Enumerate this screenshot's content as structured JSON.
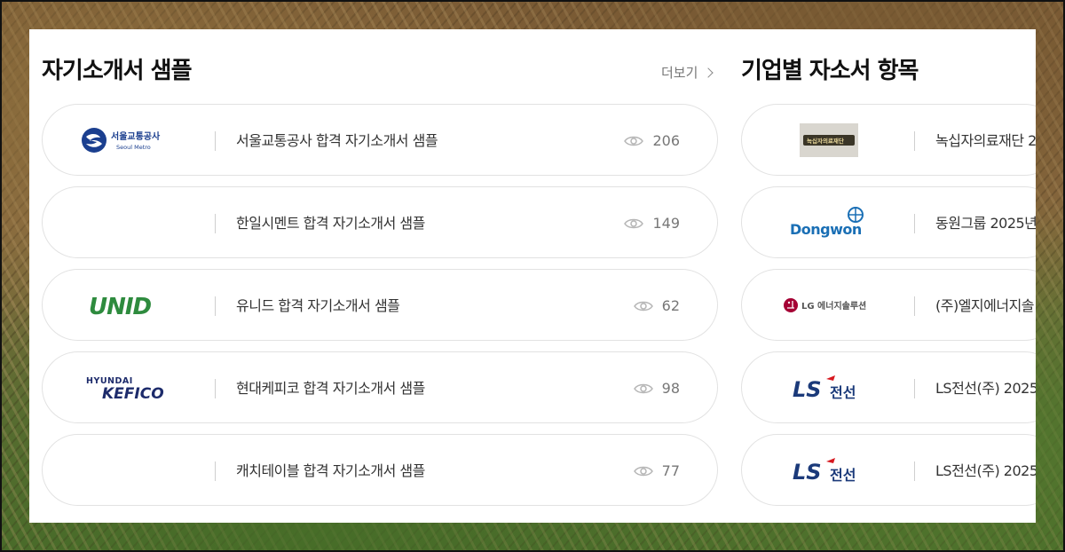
{
  "samples": {
    "title": "자기소개서 샘플",
    "more_label": "더보기",
    "items": [
      {
        "logo": "서울교통공사",
        "logo_sub": "Seoul Metro",
        "title": "서울교통공사 합격 자기소개서 샘플",
        "views": "206"
      },
      {
        "logo": "",
        "title": "한일시멘트 합격 자기소개서 샘플",
        "views": "149"
      },
      {
        "logo": "UNID",
        "title": "유니드 합격 자기소개서 샘플",
        "views": "62"
      },
      {
        "logo": "HYUNDAI",
        "logo_sub": "KEFICO",
        "title": "현대케피코 합격 자기소개서 샘플",
        "views": "98"
      },
      {
        "logo": "",
        "title": "캐치테이블 합격 자기소개서 샘플",
        "views": "77"
      }
    ]
  },
  "company": {
    "title": "기업별 자소서 항목",
    "items": [
      {
        "logo": "녹십자의료재단",
        "title": "녹십자의료재단 2"
      },
      {
        "logo": "Dongwon",
        "title": "동원그룹 2025년"
      },
      {
        "logo": "LG 에너지솔루션",
        "title": "(주)엘지에너지솔"
      },
      {
        "logo": "LS",
        "logo_sub": "전선",
        "title": "LS전선(주) 2025"
      },
      {
        "logo": "LS",
        "logo_sub": "전선",
        "title": "LS전선(주) 2025"
      }
    ]
  },
  "colors": {
    "unid_green": "#2e8b3e",
    "kefico_navy": "#1d2b6b",
    "dongwon_blue": "#1a6fb5",
    "lg_red": "#a50034",
    "ls_navy": "#1b3a7a",
    "ls_red": "#d71920",
    "seoulmetro_blue": "#1b3f8f"
  }
}
